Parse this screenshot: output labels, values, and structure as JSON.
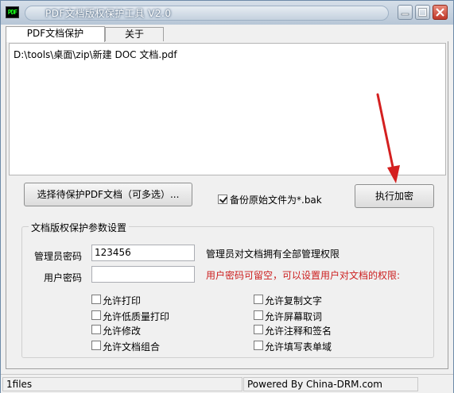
{
  "window": {
    "title": "PDF文档版权保护工具 V2.0",
    "app_icon_text": "PDF"
  },
  "tabs": [
    {
      "label": "PDF文档保护",
      "active": true
    },
    {
      "label": "关于",
      "active": false
    }
  ],
  "file_list": {
    "items": [
      "D:\\tools\\桌面\\zip\\新建 DOC 文档.pdf"
    ]
  },
  "actions": {
    "select_label": "选择待保护PDF文档（可多选）...",
    "backup_label": "备份原始文件为*.bak",
    "backup_checked": true,
    "encrypt_label": "执行加密"
  },
  "settings": {
    "group_title": "文档版权保护参数设置",
    "admin_password_label": "管理员密码",
    "admin_password_value": "123456",
    "admin_password_note": "管理员对文档拥有全部管理权限",
    "user_password_label": "用户密码",
    "user_password_value": "",
    "user_password_note": "用户密码可留空，可以设置用户对文档的权限:",
    "permissions_left": [
      {
        "label": "允许打印",
        "checked": false
      },
      {
        "label": "允许低质量打印",
        "checked": false
      },
      {
        "label": "允许修改",
        "checked": false
      },
      {
        "label": "允许文档组合",
        "checked": false
      }
    ],
    "permissions_right": [
      {
        "label": "允许复制文字",
        "checked": false
      },
      {
        "label": "允许屏幕取词",
        "checked": false
      },
      {
        "label": "允许注释和签名",
        "checked": false
      },
      {
        "label": "允许填写表单域",
        "checked": false
      }
    ]
  },
  "status": {
    "file_count": "1files",
    "powered_by": "Powered By China-DRM.com"
  },
  "colors": {
    "warning_text": "#cc1f1f",
    "annotation_arrow": "#d42020"
  }
}
